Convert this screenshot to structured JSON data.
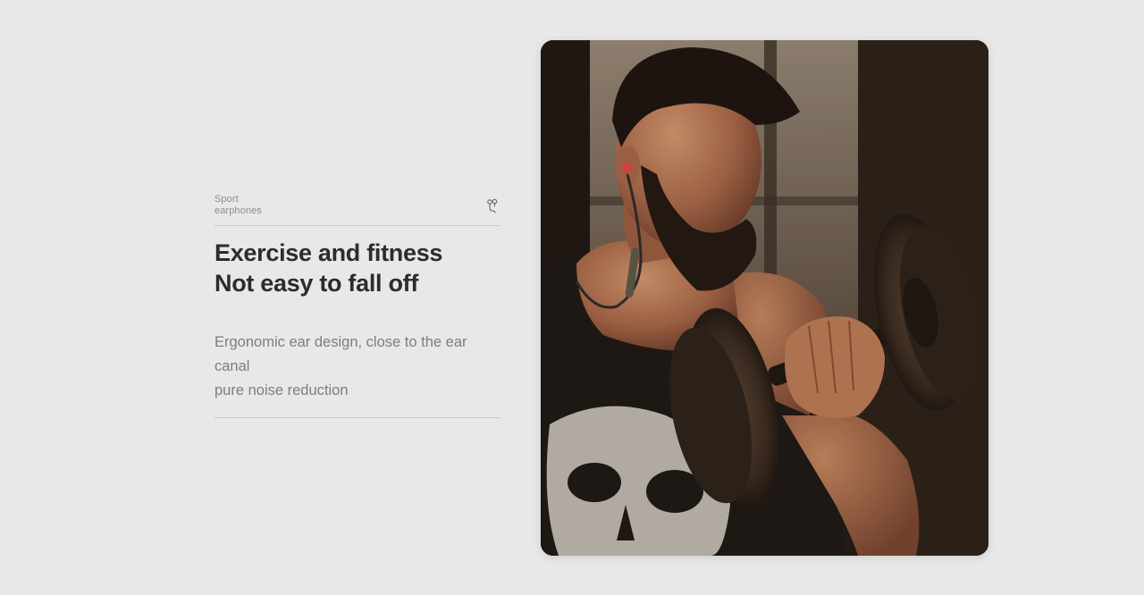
{
  "section": {
    "tag_line1": "Sport",
    "tag_line2": "earphones",
    "tag_icon": "earphone-icon",
    "headline_line1": "Exercise and fitness",
    "headline_line2": "Not easy to fall off",
    "description_line1": "Ergonomic ear design, close to the ear canal",
    "description_line2": "pure noise reduction"
  },
  "photo": {
    "subject": "man-lifting-dumbbell-wearing-earphones-image",
    "accent_color": "#e0484f"
  },
  "colors": {
    "background": "#e8e8e8",
    "headline": "#2c2c2c",
    "body_text": "#7d7d7d",
    "rule": "#c9c9c9"
  }
}
